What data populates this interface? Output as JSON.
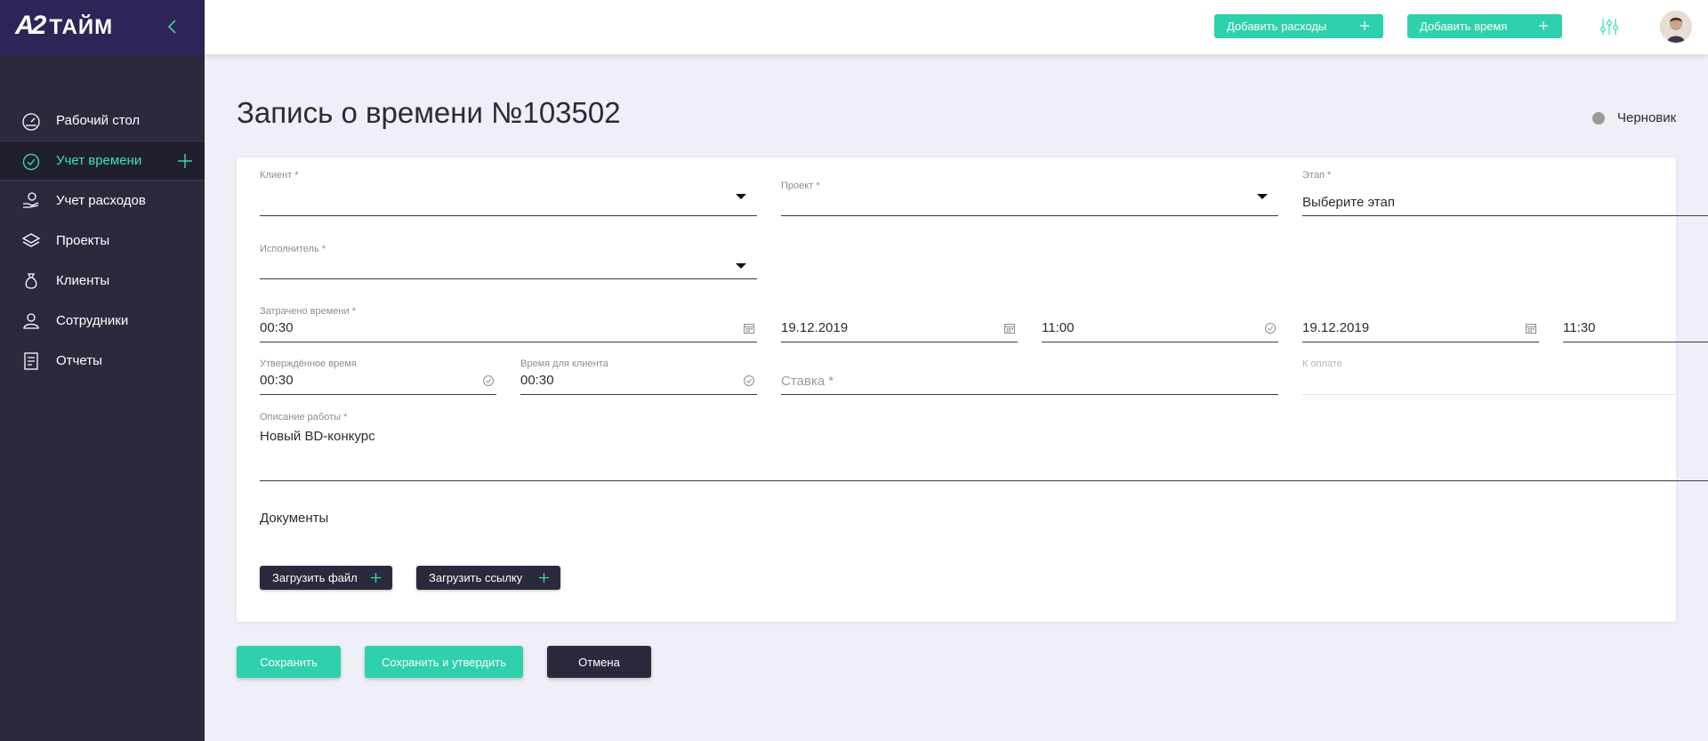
{
  "app": {
    "logo_mark": "A2",
    "logo_text": "ТАЙМ"
  },
  "sidebar": {
    "items": [
      {
        "label": "Рабочий стол",
        "icon": "dashboard-icon"
      },
      {
        "label": "Учет времени",
        "icon": "clock-icon",
        "active": true
      },
      {
        "label": "Учет расходов",
        "icon": "coins-hand-icon"
      },
      {
        "label": "Проекты",
        "icon": "layers-icon"
      },
      {
        "label": "Клиенты",
        "icon": "money-bag-icon"
      },
      {
        "label": "Сотрудники",
        "icon": "person-icon"
      },
      {
        "label": "Отчеты",
        "icon": "report-icon"
      }
    ]
  },
  "header": {
    "add_expense_label": "Добавить расходы",
    "add_time_label": "Добавить время"
  },
  "page": {
    "title": "Запись о времени №103502",
    "status": "Черновик"
  },
  "form": {
    "client": {
      "label": "Клиент *",
      "value": ""
    },
    "project": {
      "label": "Проект *",
      "value": ""
    },
    "stage": {
      "label": "Этап *",
      "value": "Выберите этап"
    },
    "performer": {
      "label": "Исполнитель *",
      "value": ""
    },
    "time_spent": {
      "label": "Затрачено времени *",
      "value": "00:30"
    },
    "start_date": {
      "value": "19.12.2019"
    },
    "start_time": {
      "value": "11:00"
    },
    "end_date": {
      "value": "19.12.2019"
    },
    "end_time": {
      "value": "11:30"
    },
    "approved_time": {
      "label": "Утверждённое время",
      "value": "00:30"
    },
    "client_time": {
      "label": "Время для клиента",
      "value": "00:30"
    },
    "rate": {
      "placeholder": "Ставка *"
    },
    "to_pay": {
      "label": "К оплате"
    },
    "description": {
      "label": "Описание работы *",
      "value": "Новый BD-конкурс"
    }
  },
  "documents": {
    "title": "Документы",
    "upload_file_label": "Загрузить файл",
    "upload_link_label": "Загрузить ссылку"
  },
  "actions": {
    "save_label": "Сохранить",
    "save_approve_label": "Сохранить и утвердить",
    "cancel_label": "Отмена"
  },
  "colors": {
    "accent": "#2ed1ab",
    "sidebar": "#2b2a3d",
    "sidebar_top": "#2f2458",
    "active_text": "#3ee0b8"
  }
}
